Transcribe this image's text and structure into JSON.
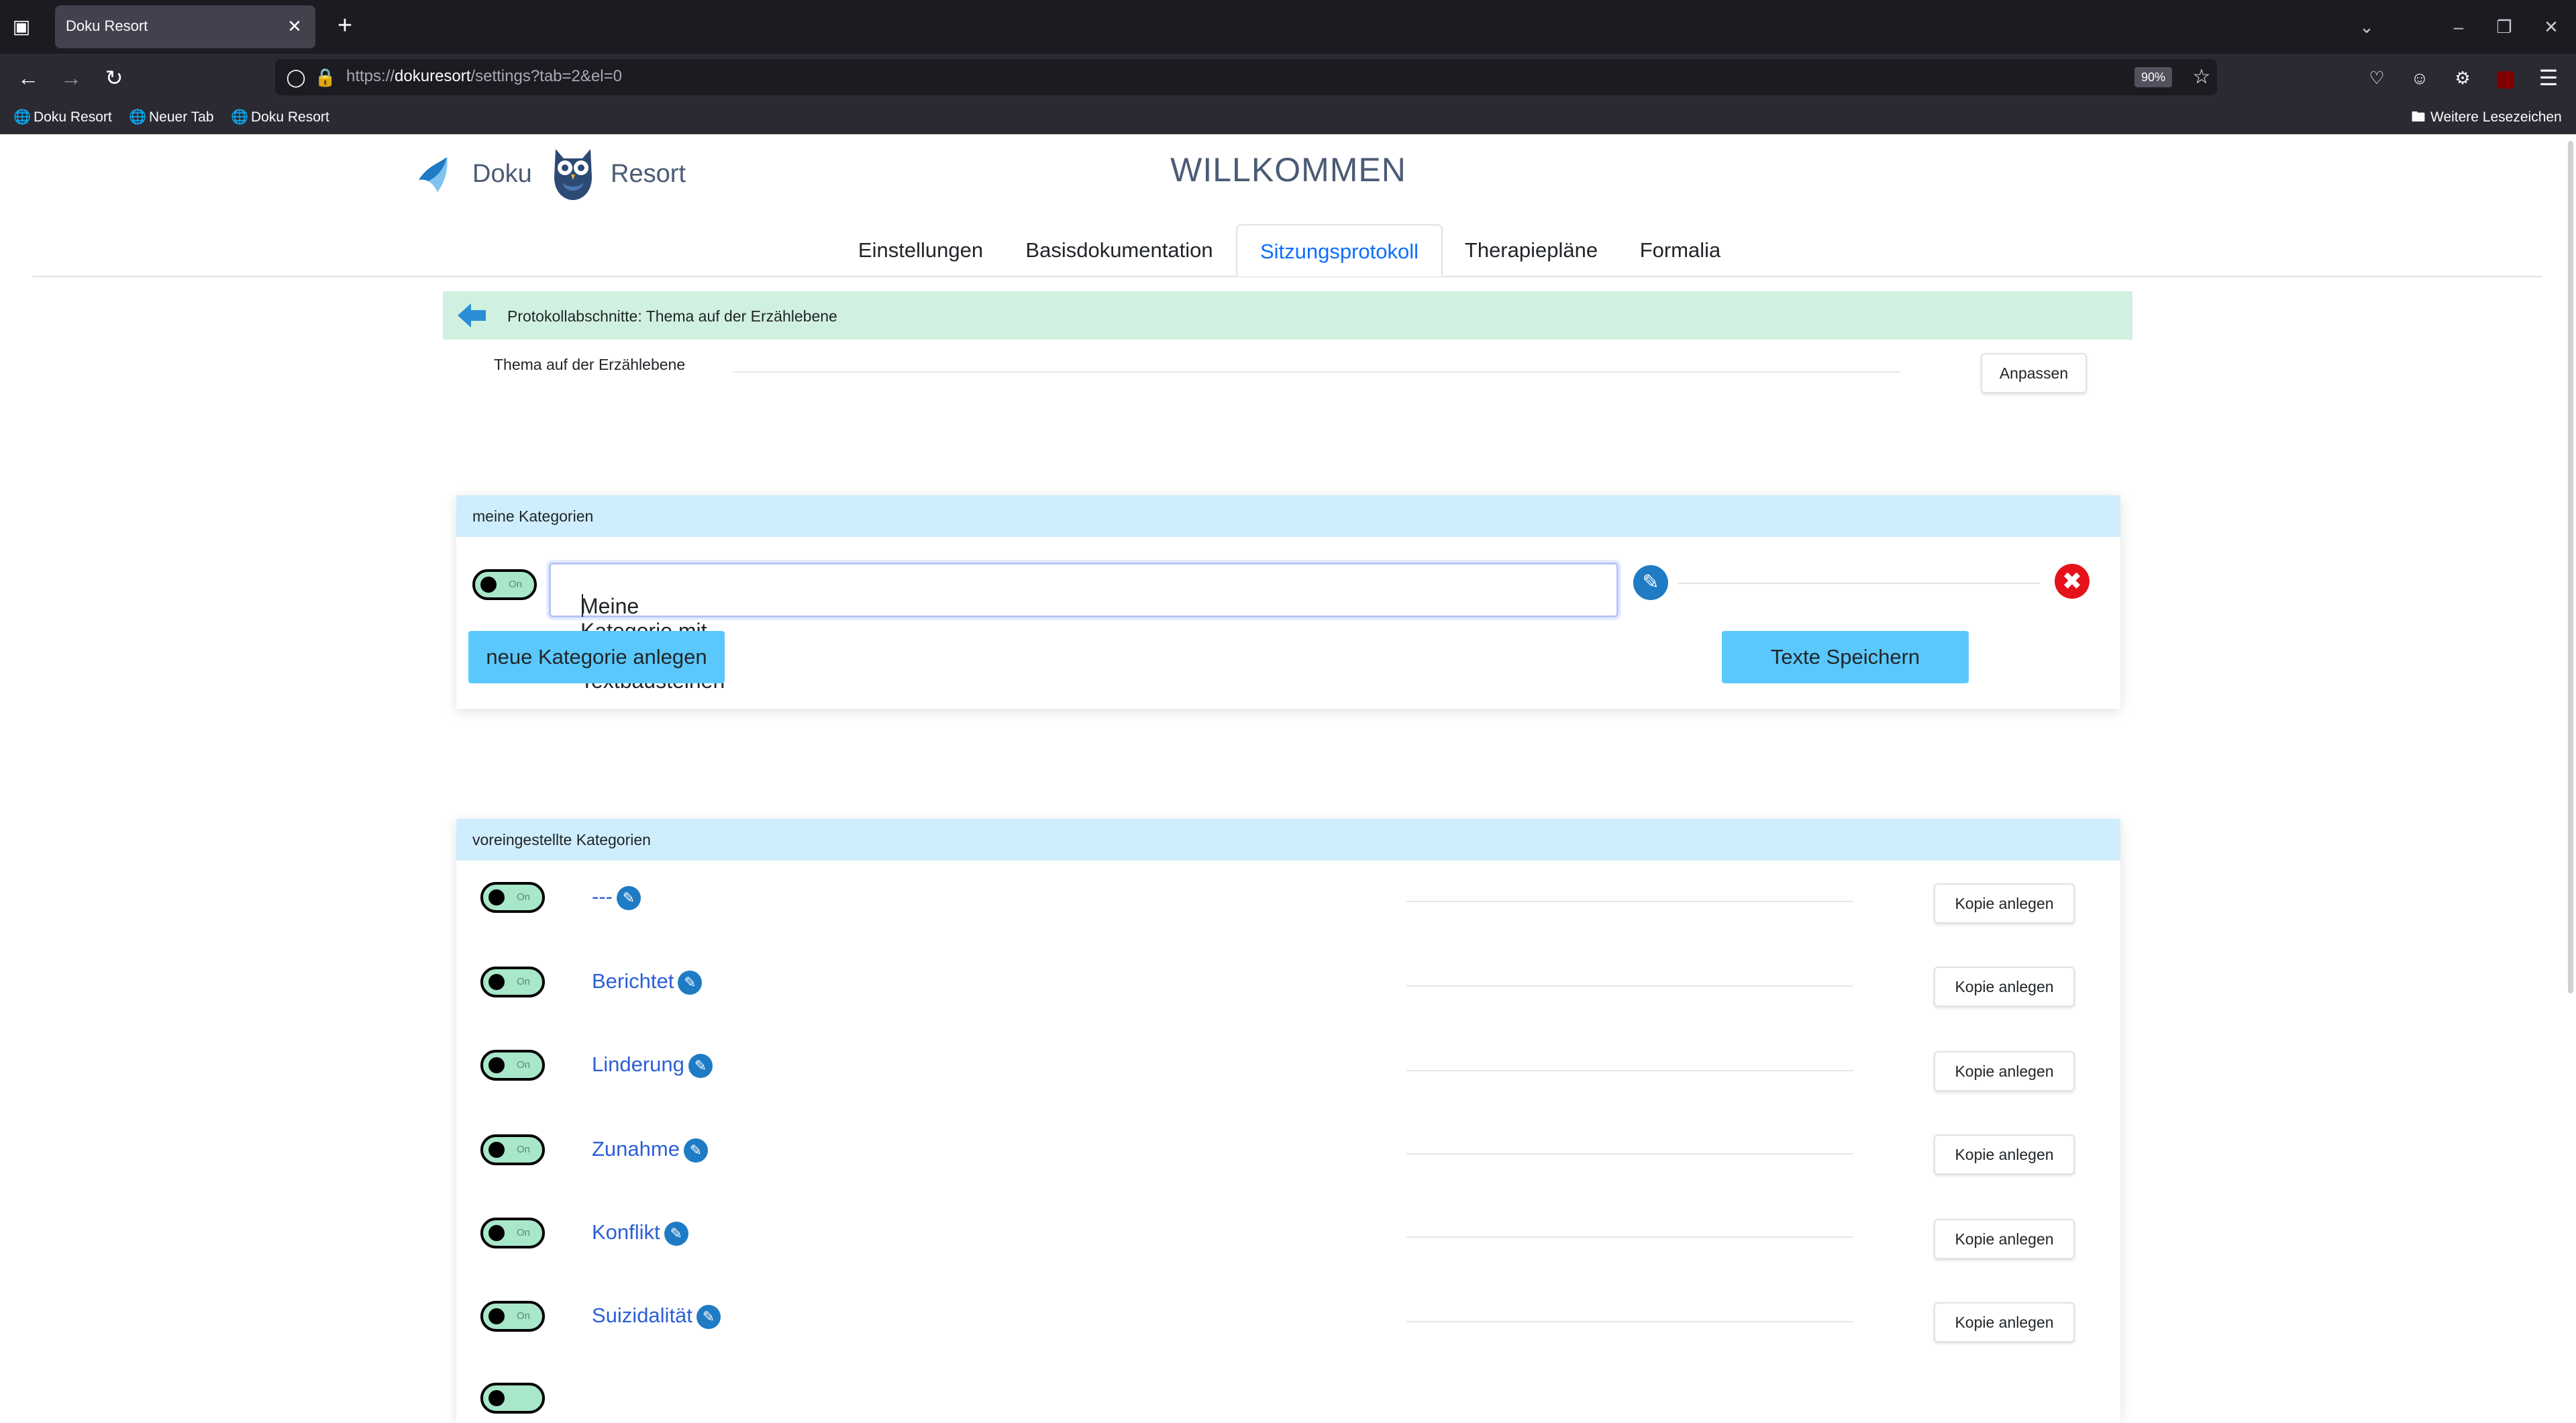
{
  "browser": {
    "tab_title": "Doku Resort",
    "url_prefix": "https://",
    "url_host": "dokuresort",
    "url_rest": "/settings?tab=2&el=0",
    "zoom": "90%",
    "bookmarks": [
      "Doku Resort",
      "Neuer Tab",
      "Doku Resort"
    ],
    "other_bookmarks": "Weitere Lesezeichen"
  },
  "header": {
    "logo_left": "Doku",
    "logo_right": "Resort",
    "welcome": "WILLKOMMEN"
  },
  "tabs": [
    "Einstellungen",
    "Basisdokumentation",
    "Sitzungsprotokoll",
    "Therapiepläne",
    "Formalia"
  ],
  "active_tab": "Sitzungsprotokoll",
  "section": {
    "title": "Protokollabschnitte: Thema auf der Erzählebene",
    "topic_label": "Thema auf der Erzählebene",
    "adjust_button": "Anpassen"
  },
  "my_categories": {
    "title": "meine Kategorien",
    "toggle_label": "On",
    "input_value": "Meine Kategorie mit meinen Textbausteinen",
    "new_button": "neue Kategorie anlegen",
    "save_button": "Texte Speichern"
  },
  "preset_categories": {
    "title": "voreingestellte Kategorien",
    "toggle_label": "On",
    "copy_button": "Kopie anlegen",
    "items": [
      "---",
      "Berichtet",
      "Linderung",
      "Zunahme",
      "Konflikt",
      "Suizidalität"
    ]
  },
  "colors": {
    "accent": "#0d6efd",
    "section_bg": "#d1f1e0",
    "card_head_bg": "#cfeefd",
    "button_blue": "#5ac8fb",
    "toggle_bg": "#a8e7c9",
    "delete_red": "#e5121a"
  }
}
